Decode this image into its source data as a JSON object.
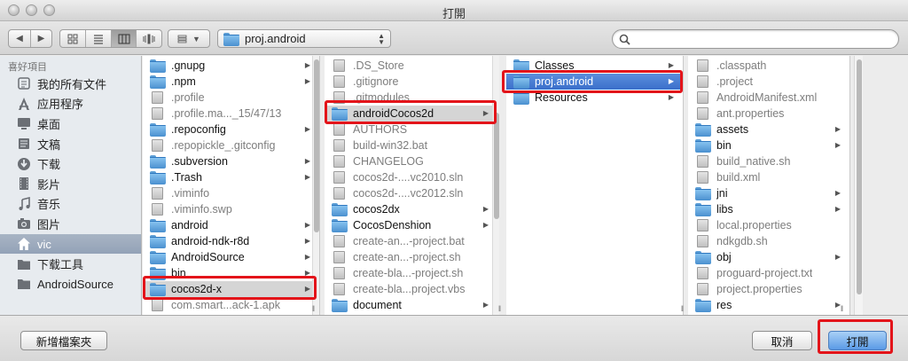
{
  "window": {
    "title": "打開"
  },
  "toolbar": {
    "path_label": "proj.android"
  },
  "sidebar": {
    "header": "喜好項目",
    "items": [
      {
        "label": "我的所有文件",
        "icon": "all-files-icon"
      },
      {
        "label": "应用程序",
        "icon": "applications-icon"
      },
      {
        "label": "桌面",
        "icon": "desktop-icon"
      },
      {
        "label": "文稿",
        "icon": "documents-icon"
      },
      {
        "label": "下载",
        "icon": "downloads-icon"
      },
      {
        "label": "影片",
        "icon": "movies-icon"
      },
      {
        "label": "音乐",
        "icon": "music-icon"
      },
      {
        "label": "图片",
        "icon": "pictures-icon"
      },
      {
        "label": "vic",
        "icon": "home-icon",
        "selected": true
      },
      {
        "label": "下载工具",
        "icon": "folder-icon"
      },
      {
        "label": "AndroidSource",
        "icon": "folder-icon"
      }
    ]
  },
  "columns": {
    "col1": [
      {
        "name": ".gnupg",
        "type": "folder",
        "arrow": true
      },
      {
        "name": ".npm",
        "type": "folder",
        "arrow": true
      },
      {
        "name": ".profile",
        "type": "file",
        "dim": true
      },
      {
        "name": ".profile.ma..._15/47/13",
        "type": "file",
        "dim": true
      },
      {
        "name": ".repoconfig",
        "type": "folder",
        "arrow": true
      },
      {
        "name": ".repopickle_.gitconfig",
        "type": "file",
        "dim": true
      },
      {
        "name": ".subversion",
        "type": "folder",
        "arrow": true
      },
      {
        "name": ".Trash",
        "type": "folder",
        "arrow": true
      },
      {
        "name": ".viminfo",
        "type": "file",
        "dim": true
      },
      {
        "name": ".viminfo.swp",
        "type": "file",
        "dim": true
      },
      {
        "name": "android",
        "type": "folder",
        "arrow": true
      },
      {
        "name": "android-ndk-r8d",
        "type": "folder",
        "arrow": true
      },
      {
        "name": "AndroidSource",
        "type": "folder",
        "arrow": true
      },
      {
        "name": "bin",
        "type": "folder",
        "arrow": true
      },
      {
        "name": "cocos2d-x",
        "type": "folder",
        "arrow": true,
        "hilite": true
      },
      {
        "name": "com.smart...ack-1.apk",
        "type": "file",
        "dim": true
      }
    ],
    "col2": [
      {
        "name": ".DS_Store",
        "type": "file",
        "dim": true
      },
      {
        "name": ".gitignore",
        "type": "file",
        "dim": true
      },
      {
        "name": ".gitmodules",
        "type": "file",
        "dim": true
      },
      {
        "name": "androidCocos2d",
        "type": "folder",
        "arrow": true,
        "hilite": true
      },
      {
        "name": "AUTHORS",
        "type": "file",
        "dim": true
      },
      {
        "name": "build-win32.bat",
        "type": "file",
        "dim": true
      },
      {
        "name": "CHANGELOG",
        "type": "file",
        "dim": true
      },
      {
        "name": "cocos2d-....vc2010.sln",
        "type": "file",
        "dim": true
      },
      {
        "name": "cocos2d-....vc2012.sln",
        "type": "file",
        "dim": true
      },
      {
        "name": "cocos2dx",
        "type": "folder",
        "arrow": true
      },
      {
        "name": "CocosDenshion",
        "type": "folder",
        "arrow": true
      },
      {
        "name": "create-an...-project.bat",
        "type": "file",
        "dim": true
      },
      {
        "name": "create-an...-project.sh",
        "type": "file",
        "dim": true
      },
      {
        "name": "create-bla...-project.sh",
        "type": "file",
        "dim": true
      },
      {
        "name": "create-bla...project.vbs",
        "type": "file",
        "dim": true
      },
      {
        "name": "document",
        "type": "folder",
        "arrow": true
      }
    ],
    "col3": [
      {
        "name": "Classes",
        "type": "folder",
        "arrow": true
      },
      {
        "name": "proj.android",
        "type": "folder",
        "arrow": true,
        "selected": true
      },
      {
        "name": "Resources",
        "type": "folder",
        "arrow": true
      }
    ],
    "col4": [
      {
        "name": ".classpath",
        "type": "file",
        "dim": true
      },
      {
        "name": ".project",
        "type": "file",
        "dim": true
      },
      {
        "name": "AndroidManifest.xml",
        "type": "file",
        "dim": true
      },
      {
        "name": "ant.properties",
        "type": "file",
        "dim": true
      },
      {
        "name": "assets",
        "type": "folder",
        "arrow": true
      },
      {
        "name": "bin",
        "type": "folder",
        "arrow": true
      },
      {
        "name": "build_native.sh",
        "type": "file",
        "dim": true
      },
      {
        "name": "build.xml",
        "type": "file",
        "dim": true
      },
      {
        "name": "jni",
        "type": "folder",
        "arrow": true
      },
      {
        "name": "libs",
        "type": "folder",
        "arrow": true
      },
      {
        "name": "local.properties",
        "type": "file",
        "dim": true
      },
      {
        "name": "ndkgdb.sh",
        "type": "file",
        "dim": true
      },
      {
        "name": "obj",
        "type": "folder",
        "arrow": true
      },
      {
        "name": "proguard-project.txt",
        "type": "file",
        "dim": true
      },
      {
        "name": "project.properties",
        "type": "file",
        "dim": true
      },
      {
        "name": "res",
        "type": "folder",
        "arrow": true
      }
    ]
  },
  "buttons": {
    "new_folder": "新增檔案夾",
    "cancel": "取消",
    "open": "打開"
  },
  "colors": {
    "selection": "#3a6fcb",
    "annotation": "#e3141a",
    "folder": "#4a90cf"
  }
}
